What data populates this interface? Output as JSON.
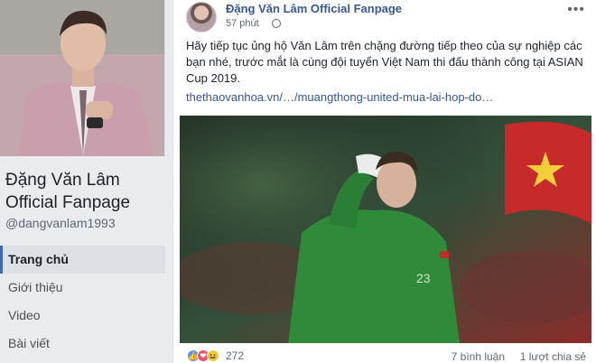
{
  "page": {
    "name": "Đặng Văn Lâm Official Fanpage",
    "handle": "@dangvanlam1993"
  },
  "nav": {
    "items": [
      {
        "label": "Trang chủ",
        "active": true
      },
      {
        "label": "Giới thiệu"
      },
      {
        "label": "Video"
      },
      {
        "label": "Bài viết"
      }
    ]
  },
  "post": {
    "author": "Đặng Văn Lâm Official Fanpage",
    "time": "57 phút",
    "text": "Hãy tiếp tục ủng hộ Văn Lâm trên chặng đường tiếp theo của sự nghiệp các bạn nhé, trước mắt là cùng đội tuyển Việt Nam thi đấu thành công tại ASIAN Cup 2019.",
    "link": "thethaovanhoa.vn/…/muangthong-united-mua-lai-hop-do…",
    "reaction_count": "272",
    "comments": "7 bình luận",
    "shares": "1 lượt chia sẻ",
    "more_icon": "more-icon",
    "colors": {
      "link": "#365899",
      "like": "#5890ff",
      "love": "#f25268",
      "haha": "#f7c947"
    }
  }
}
